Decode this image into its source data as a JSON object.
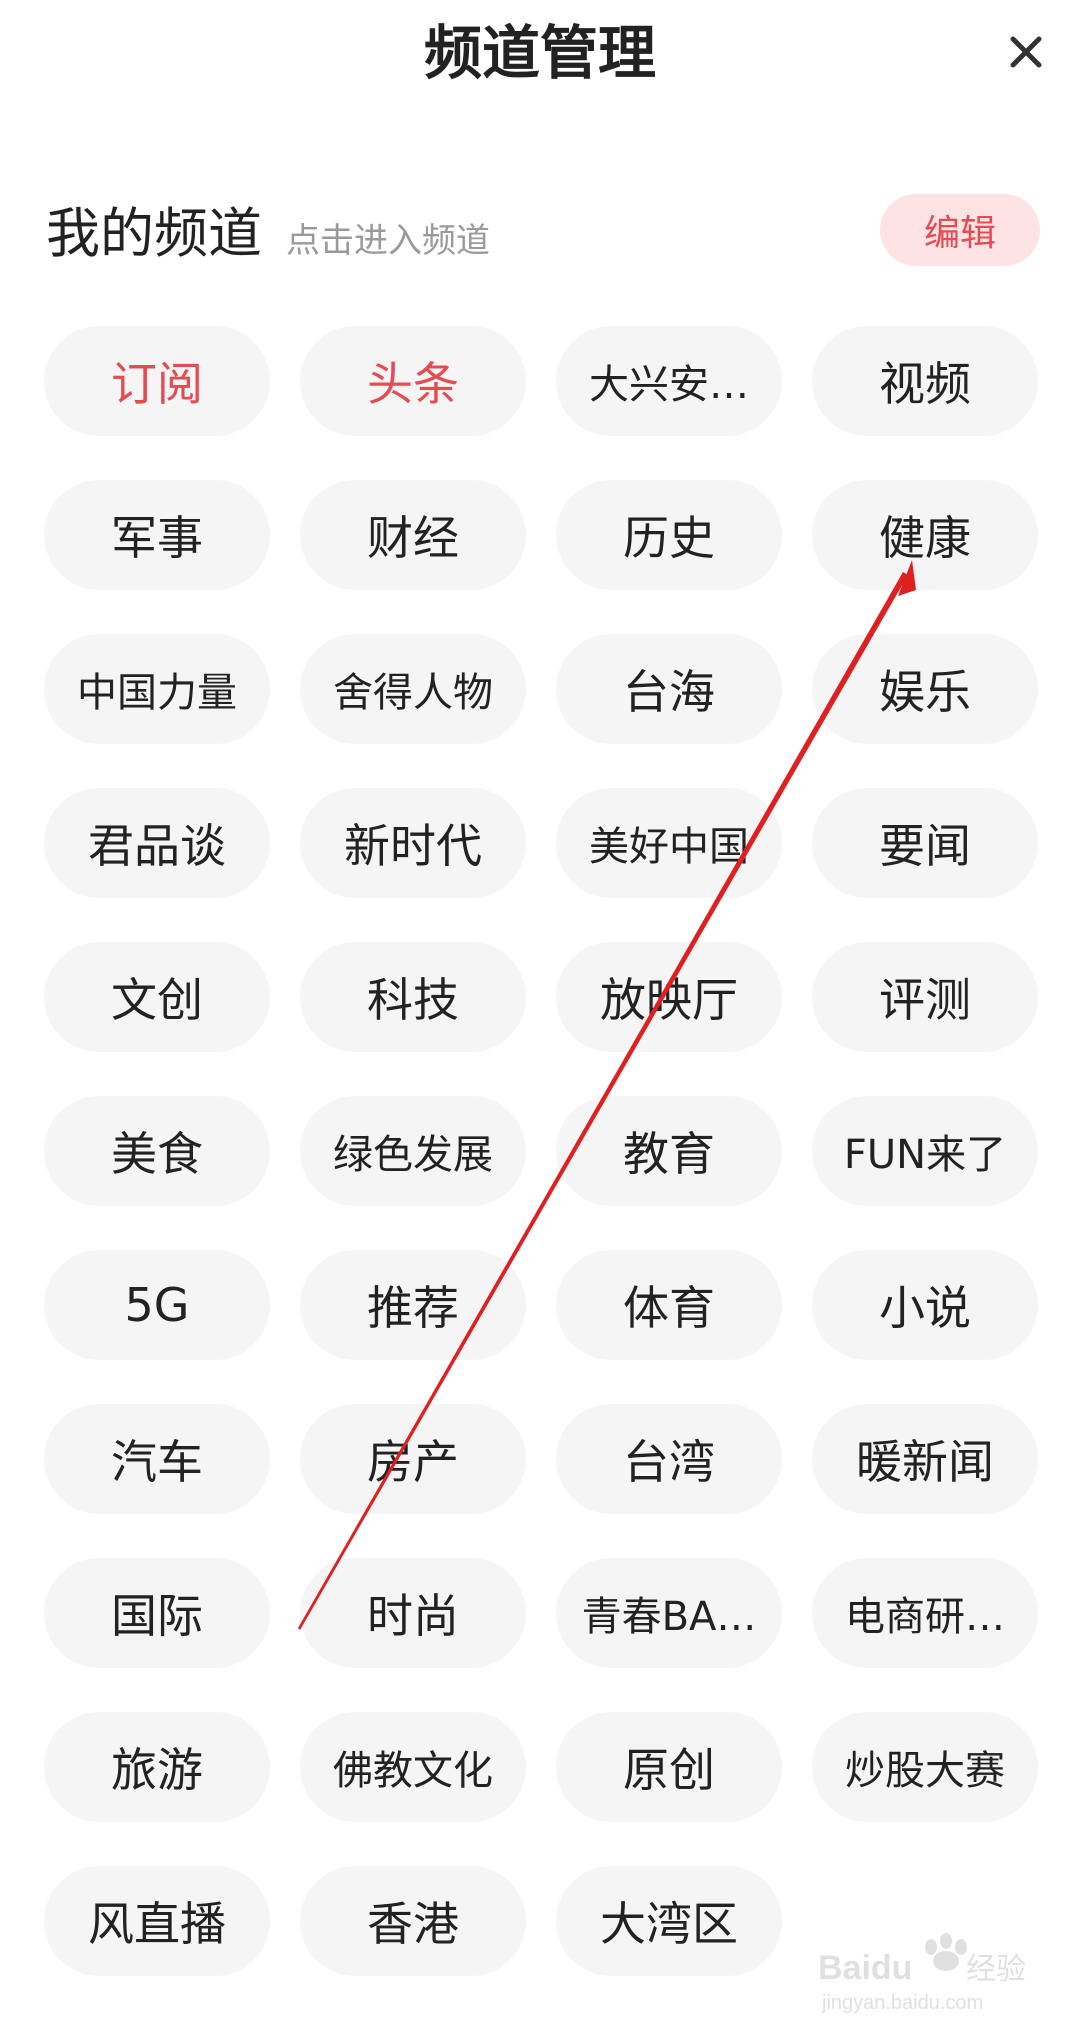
{
  "header": {
    "title": "频道管理",
    "close_icon": "close-icon"
  },
  "section": {
    "title": "我的频道",
    "hint": "点击进入频道",
    "edit_label": "编辑"
  },
  "colors": {
    "accent": "#e64b52",
    "accent_bg": "#fde3e4",
    "chip_bg": "#f5f5f5",
    "annotation_arrow": "#e02020"
  },
  "channels": [
    {
      "label": "订阅",
      "active": true
    },
    {
      "label": "头条",
      "active": true
    },
    {
      "label": "大兴安…"
    },
    {
      "label": "视频"
    },
    {
      "label": "军事"
    },
    {
      "label": "财经"
    },
    {
      "label": "历史"
    },
    {
      "label": "健康"
    },
    {
      "label": "中国力量"
    },
    {
      "label": "舍得人物"
    },
    {
      "label": "台海"
    },
    {
      "label": "娱乐"
    },
    {
      "label": "君品谈"
    },
    {
      "label": "新时代"
    },
    {
      "label": "美好中国"
    },
    {
      "label": "要闻"
    },
    {
      "label": "文创"
    },
    {
      "label": "科技"
    },
    {
      "label": "放映厅"
    },
    {
      "label": "评测"
    },
    {
      "label": "美食"
    },
    {
      "label": "绿色发展"
    },
    {
      "label": "教育"
    },
    {
      "label": "FUN来了"
    },
    {
      "label": "5G"
    },
    {
      "label": "推荐"
    },
    {
      "label": "体育"
    },
    {
      "label": "小说"
    },
    {
      "label": "汽车"
    },
    {
      "label": "房产"
    },
    {
      "label": "台湾"
    },
    {
      "label": "暖新闻"
    },
    {
      "label": "国际"
    },
    {
      "label": "时尚"
    },
    {
      "label": "青春BA…"
    },
    {
      "label": "电商研…"
    },
    {
      "label": "旅游"
    },
    {
      "label": "佛教文化"
    },
    {
      "label": "原创"
    },
    {
      "label": "炒股大赛"
    },
    {
      "label": "风直播"
    },
    {
      "label": "香港"
    },
    {
      "label": "大湾区"
    }
  ],
  "watermark": {
    "brand": "Baidu",
    "label": "经验",
    "url_text": "jingyan.baidu.com"
  }
}
